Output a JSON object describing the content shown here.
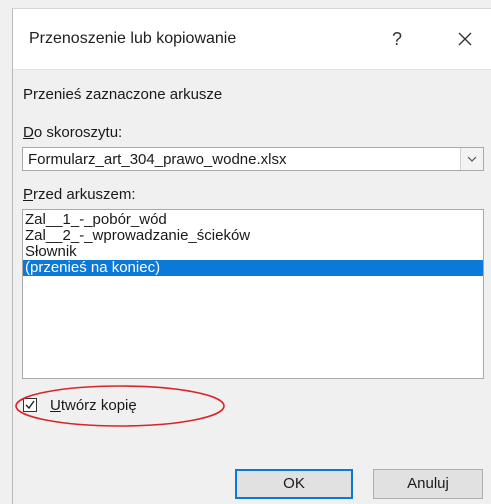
{
  "dialog": {
    "title": "Przenoszenie lub kopiowanie",
    "help_label": "?",
    "heading": "Przenieś zaznaczone arkusze",
    "to_book": {
      "label_accel": "D",
      "label_rest": "o skoroszytu:",
      "value": "Formularz_art_304_prawo_wodne.xlsx"
    },
    "before_sheet": {
      "label_accel": "P",
      "label_rest": "rzed arkuszem:",
      "items": [
        "Zal__1_-_pobór_wód",
        "Zal__2_-_wprowadzanie_ścieków",
        "Słownik",
        "(przenieś na koniec)"
      ],
      "selected_index": 3
    },
    "create_copy": {
      "label_accel": "U",
      "label_rest": "twórz kopię",
      "checked": true
    },
    "ok_label": "OK",
    "cancel_label": "Anuluj"
  },
  "colors": {
    "selection": "#0a79d8",
    "annotation": "#d9252a"
  }
}
